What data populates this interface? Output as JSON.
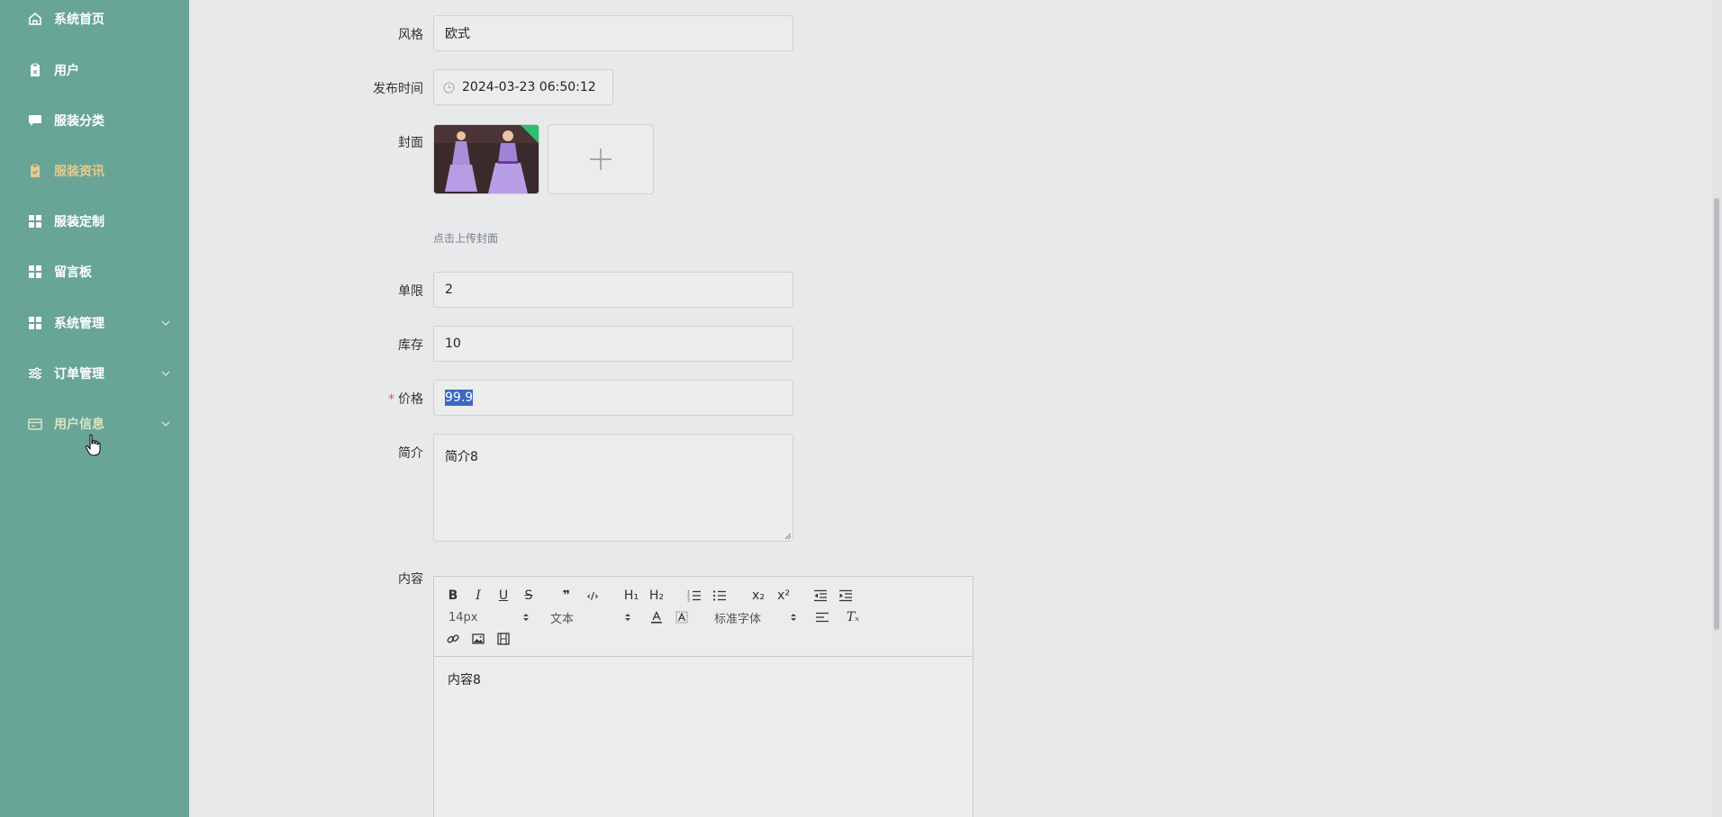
{
  "sidebar": {
    "items": [
      {
        "label": "系统首页",
        "icon": "home-icon"
      },
      {
        "label": "用户",
        "icon": "clipboard-icon"
      },
      {
        "label": "服装分类",
        "icon": "message-icon"
      },
      {
        "label": "服装资讯",
        "icon": "clipboard-check-icon"
      },
      {
        "label": "服装定制",
        "icon": "grid-icon"
      },
      {
        "label": "留言板",
        "icon": "grid-icon"
      },
      {
        "label": "系统管理",
        "icon": "grid-icon"
      },
      {
        "label": "订单管理",
        "icon": "sliders-icon"
      },
      {
        "label": "用户信息",
        "icon": "card-icon"
      }
    ]
  },
  "form": {
    "style_label": "风格",
    "style_value": "欧式",
    "publish_time_label": "发布时间",
    "publish_time_value": "2024-03-23 06:50:12",
    "cover_label": "封面",
    "cover_hint": "点击上传封面",
    "limit_label": "单限",
    "limit_value": "2",
    "stock_label": "库存",
    "stock_value": "10",
    "price_required": "*",
    "price_label": "价格",
    "price_value": "99.9",
    "intro_label": "简介",
    "intro_value": "简介8",
    "content_label": "内容",
    "content_value": "内容8"
  },
  "editor": {
    "font_size": "14px",
    "block_type": "文本",
    "font_family": "标准字体",
    "buttons": {
      "bold": "B",
      "italic": "I",
      "underline": "U",
      "strike": "S",
      "quote": "❞",
      "code": "‹/›",
      "h1": "H₁",
      "h2": "H₂",
      "sub": "x₂",
      "sup": "x²",
      "clear": "Tₓ"
    }
  },
  "colors": {
    "sidebar_bg": "#68a597",
    "active_text": "#e9c98a",
    "selection": "#3b68c4",
    "required": "#e05555"
  }
}
